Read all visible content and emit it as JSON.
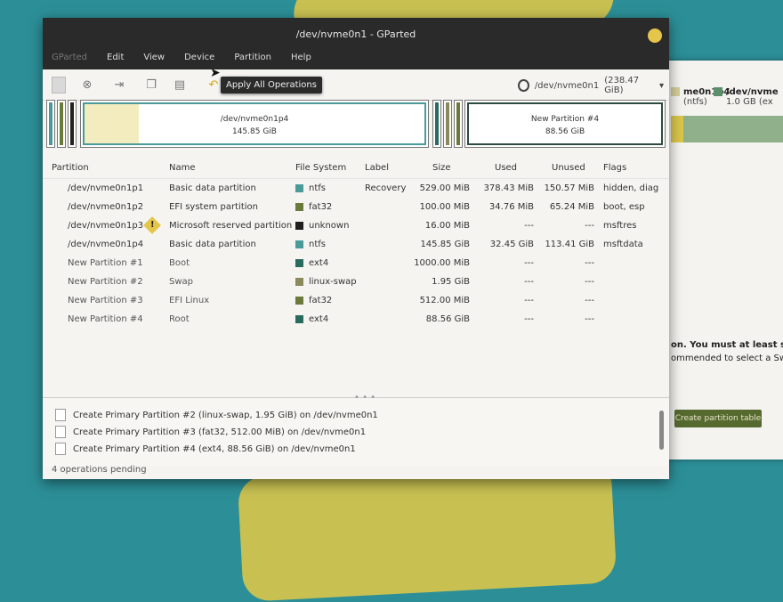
{
  "window": {
    "title": "/dev/nvme0n1 - GParted"
  },
  "menu": [
    "GParted",
    "Edit",
    "View",
    "Device",
    "Partition",
    "Help"
  ],
  "toolbar": {
    "device": "/dev/nvme0n1",
    "device_size": "(238.47 GiB)",
    "tooltip": "Apply All Operations"
  },
  "diskmap": {
    "seg1": {
      "name": "/dev/nvme0n1p4",
      "size": "145.85 GiB"
    },
    "seg2": {
      "name": "New Partition #4",
      "size": "88.56 GiB"
    }
  },
  "table": {
    "headers": {
      "partition": "Partition",
      "name": "Name",
      "fs": "File System",
      "label": "Label",
      "size": "Size",
      "used": "Used",
      "unused": "Unused",
      "flags": "Flags"
    },
    "rows": [
      {
        "partition": "/dev/nvme0n1p1",
        "name": "Basic data partition",
        "fs": "ntfs",
        "fs_color": "#4a9a9a",
        "label": "Recovery",
        "size": "529.00 MiB",
        "used": "378.43 MiB",
        "unused": "150.57 MiB",
        "flags": "hidden, diag"
      },
      {
        "partition": "/dev/nvme0n1p2",
        "name": "EFI system partition",
        "fs": "fat32",
        "fs_color": "#6b7a3a",
        "label": "",
        "size": "100.00 MiB",
        "used": "34.76 MiB",
        "unused": "65.24 MiB",
        "flags": "boot, esp"
      },
      {
        "partition": "/dev/nvme0n1p3",
        "name": "Microsoft reserved partition",
        "fs": "unknown",
        "fs_color": "#1e1e1e",
        "label": "",
        "size": "16.00 MiB",
        "used": "---",
        "unused": "---",
        "flags": "msftres"
      },
      {
        "partition": "/dev/nvme0n1p4",
        "name": "Basic data partition",
        "fs": "ntfs",
        "fs_color": "#4a9a9a",
        "label": "",
        "size": "145.85 GiB",
        "used": "32.45 GiB",
        "unused": "113.41 GiB",
        "flags": "msftdata"
      },
      {
        "partition": "New Partition #1",
        "name": "Boot",
        "fs": "ext4",
        "fs_color": "#2a6b60",
        "label": "",
        "size": "1000.00 MiB",
        "used": "---",
        "unused": "---",
        "flags": ""
      },
      {
        "partition": "New Partition #2",
        "name": "Swap",
        "fs": "linux-swap",
        "fs_color": "#8a8a5a",
        "label": "",
        "size": "1.95 GiB",
        "used": "---",
        "unused": "---",
        "flags": ""
      },
      {
        "partition": "New Partition #3",
        "name": "EFI Linux",
        "fs": "fat32",
        "fs_color": "#6b7a3a",
        "label": "",
        "size": "512.00 MiB",
        "used": "---",
        "unused": "---",
        "flags": ""
      },
      {
        "partition": "New Partition #4",
        "name": "Root",
        "fs": "ext4",
        "fs_color": "#2a6b60",
        "label": "",
        "size": "88.56 GiB",
        "used": "---",
        "unused": "---",
        "flags": ""
      }
    ]
  },
  "operations": [
    "Create Primary Partition #2 (linux-swap, 1.95 GiB) on /dev/nvme0n1",
    "Create Primary Partition #3 (fat32, 512.00 MiB) on /dev/nvme0n1",
    "Create Primary Partition #4 (ext4, 88.56 GiB) on /dev/nvme0n1"
  ],
  "status": "4 operations pending",
  "installer": {
    "legend1": "me0n1p4",
    "legend1_sub": "(ntfs)",
    "legend2": "/dev/nvme",
    "legend2_sub": "1.0 GB (ex",
    "msg_line1": "on. You must at least select",
    "msg_line2": "ommended to select a Swap",
    "button": "Create partition table"
  }
}
